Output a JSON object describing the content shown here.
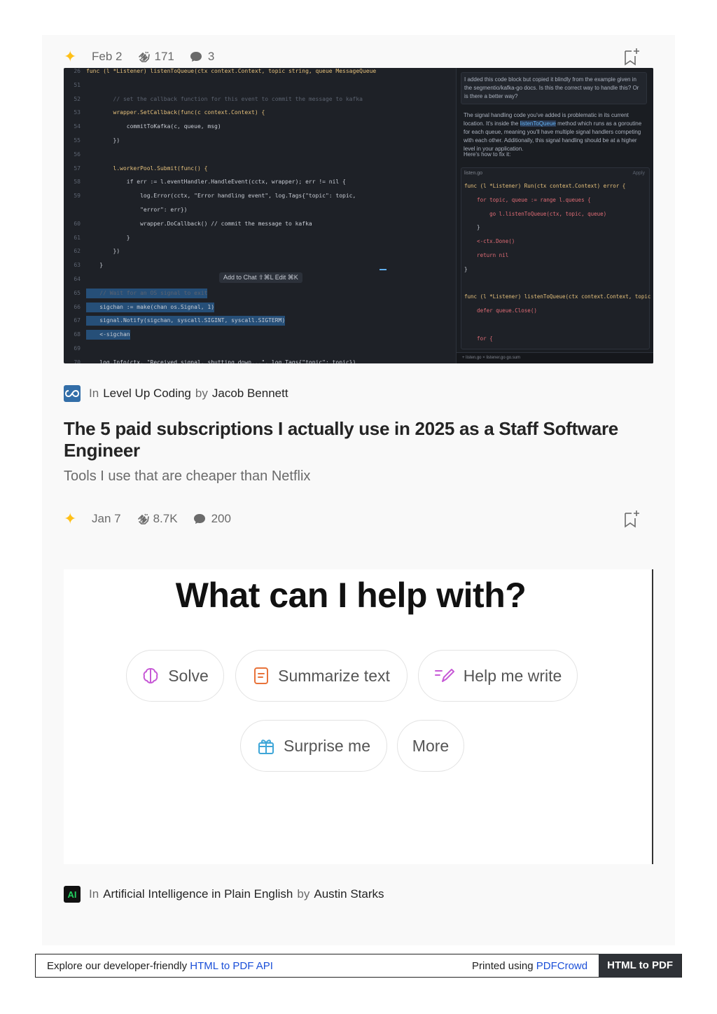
{
  "article1": {
    "date": "Feb 2",
    "claps": "171",
    "responses": "3",
    "screenshot": {
      "code_lines": [
        {
          "n": "26",
          "t": "func (l *Listener) listenToQueue(ctx context.Context, topic string, queue MessageQueue"
        },
        {
          "n": "51",
          "t": ""
        },
        {
          "n": "52",
          "t": "        // set the callback function for this event to commit the message to kafka"
        },
        {
          "n": "53",
          "t": "        wrapper.SetCallback(func(c context.Context) {"
        },
        {
          "n": "54",
          "t": "            commitToKafka(c, queue, msg)"
        },
        {
          "n": "55",
          "t": "        })"
        },
        {
          "n": "56",
          "t": ""
        },
        {
          "n": "57",
          "t": "        l.workerPool.Submit(func() {"
        },
        {
          "n": "58",
          "t": "            if err := l.eventHandler.HandleEvent(cctx, wrapper); err != nil {"
        },
        {
          "n": "59",
          "t": "                log.Error(cctx, \"Error handling event\", log.Tags{\"topic\": topic,"
        },
        {
          "n": "",
          "t": "                \"error\": err})"
        },
        {
          "n": "60",
          "t": "                wrapper.DoCallback() // commit the message to kafka"
        },
        {
          "n": "61",
          "t": "            }"
        },
        {
          "n": "62",
          "t": "        })"
        },
        {
          "n": "63",
          "t": "    }"
        },
        {
          "n": "64",
          "t": ""
        },
        {
          "n": "65",
          "t": "    // Wait for an OS signal to exit"
        },
        {
          "n": "66",
          "t": "    sigchan := make(chan os.Signal, 1)"
        },
        {
          "n": "67",
          "t": "    signal.Notify(sigchan, syscall.SIGINT, syscall.SIGTERM)"
        },
        {
          "n": "68",
          "t": "    <-sigchan"
        },
        {
          "n": "69",
          "t": ""
        },
        {
          "n": "70",
          "t": "    log.Info(ctx, \"Received signal, shutting down...\", log.Tags{\"topic\": topic})"
        }
      ],
      "context_menu": "Add to Chat ⇧⌘L    Edit ⌘K",
      "chat_question": "I added this code block but copied it blindly from the example given in the segmentio/kafka-go docs. Is this the correct way to handle this? Or is there a better way?",
      "chat_answer_pre": "The signal handling code you've added is problematic in its current location. It's inside the",
      "chat_answer_hl": "listenToQueue",
      "chat_answer_post": "method which runs as a goroutine for each queue, meaning you'll have multiple signal handlers competing with each other. Additionally, this signal handling should be at a higher level in your application.",
      "chat_fix": "Here's how to fix it:",
      "chat_file": "listen.go",
      "chat_apply": "Apply",
      "chat_code": [
        "func (l *Listener) Run(ctx context.Context) error {",
        "    for topic, queue := range l.queues {",
        "        go l.listenToQueue(ctx, topic, queue)",
        "    }",
        "    <-ctx.Done()",
        "    return nil",
        "}",
        "",
        "func (l *Listener) listenToQueue(ctx context.Context, topic string, queue",
        "    defer queue.Close()",
        "",
        "    for {"
      ],
      "tabs": "+  listen.go ×   listener.go   go.sum"
    }
  },
  "article2": {
    "in_label": "In",
    "publication": "Level Up Coding",
    "by_label": "by",
    "author": "Jacob Bennett",
    "title": "The 5 paid subscriptions I actually use in 2025 as a Staff Software Engineer",
    "subtitle": "Tools I use that are cheaper than Netflix",
    "date": "Jan 7",
    "claps": "8.7K",
    "responses": "200",
    "screenshot": {
      "heading": "What can I help with?",
      "chips": {
        "solve": "Solve",
        "summarize": "Summarize text",
        "help_write": "Help me write",
        "surprise": "Surprise me",
        "more": "More"
      }
    }
  },
  "article3": {
    "in_label": "In",
    "publication_logo": "AI",
    "publication": "Artificial Intelligence in Plain English",
    "by_label": "by",
    "author": "Austin Starks"
  },
  "footer": {
    "explore_text": "Explore our developer-friendly",
    "explore_link": "HTML to PDF API",
    "printed_text": "Printed using",
    "printed_link": "PDFCrowd",
    "badge": "HTML to PDF"
  },
  "colors": {
    "star": "#ffc017",
    "link": "#1a4fd8",
    "solve_icon": "#c75ad6",
    "summarize_icon": "#e8733a",
    "write_icon": "#c75ad6",
    "surprise_icon": "#3ea6d8"
  }
}
